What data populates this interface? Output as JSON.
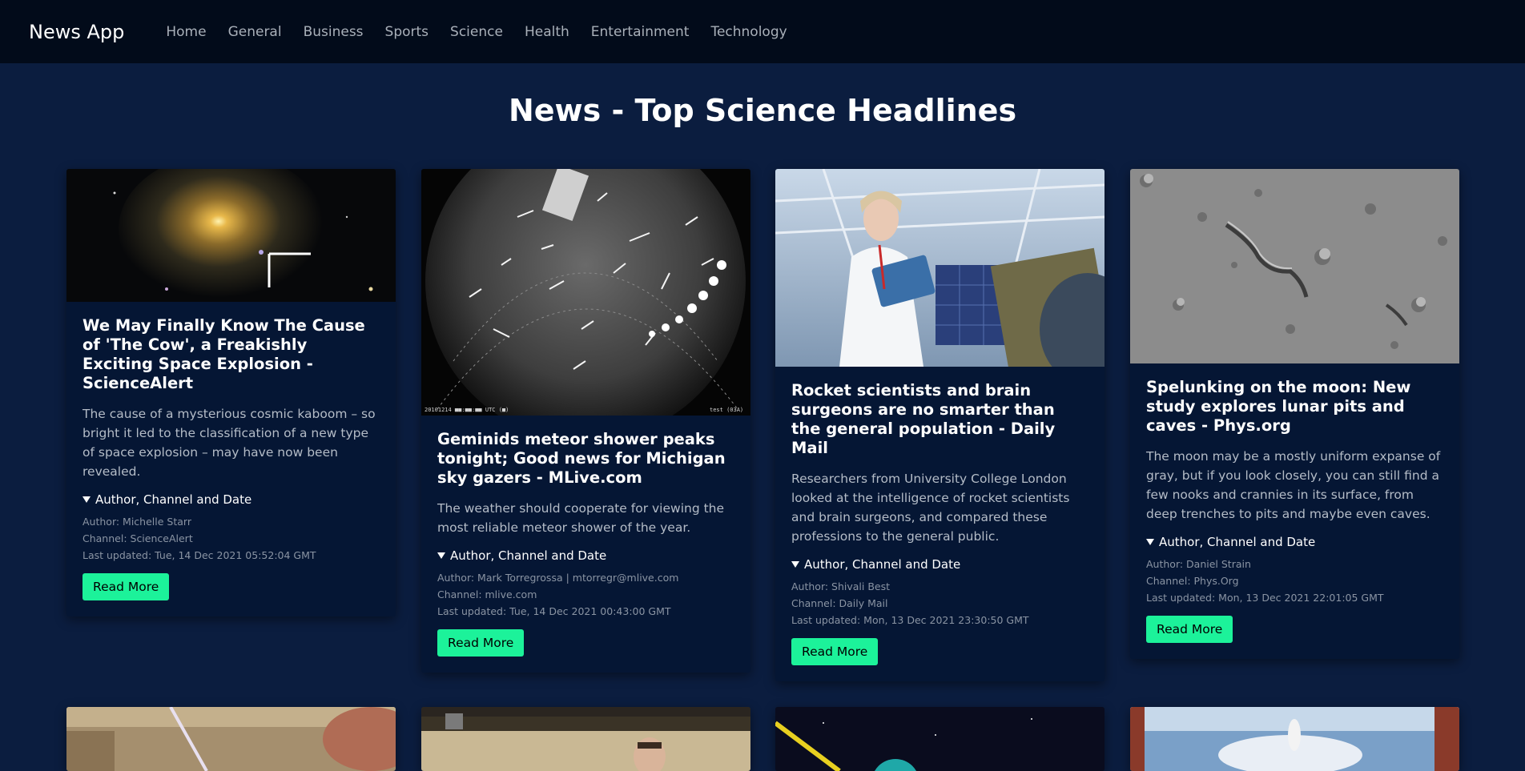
{
  "nav": {
    "brand": "News App",
    "links": [
      "Home",
      "General",
      "Business",
      "Sports",
      "Science",
      "Health",
      "Entertainment",
      "Technology"
    ]
  },
  "page": {
    "title": "News - Top Science Headlines"
  },
  "labels": {
    "details_summary": "Author, Channel and Date",
    "read_more": "Read More"
  },
  "articles": [
    {
      "title": "We May Finally Know The Cause of 'The Cow', a Freakishly Exciting Space Explosion - ScienceAlert",
      "description": "The cause of a mysterious cosmic kaboom – so bright it led to the classification of a new type of space explosion – may have now been revealed.",
      "author": "Author: Michelle Starr",
      "channel": "Channel: ScienceAlert",
      "updated": "Last updated: Tue, 14 Dec 2021 05:52:04 GMT",
      "image": "galaxy-explosion-image"
    },
    {
      "title": "Geminids meteor shower peaks tonight; Good news for Michigan sky gazers - MLive.com",
      "description": "The weather should cooperate for viewing the most reliable meteor shower of the year.",
      "author": "Author: Mark Torregrossa | mtorregr@mlive.com",
      "channel": "Channel: mlive.com",
      "updated": "Last updated: Tue, 14 Dec 2021 00:43:00 GMT",
      "image": "meteor-allsky-image",
      "image_caption_left": "20101214 ■■:■■:■■ UTC (■)",
      "image_caption_right": "test (03A)"
    },
    {
      "title": "Rocket scientists and brain surgeons are no smarter than the general population - Daily Mail",
      "description": "Researchers from University College London looked at the intelligence of rocket scientists and brain surgeons, and compared these professions to the general public.",
      "author": "Author: Shivali Best",
      "channel": "Channel: Daily Mail",
      "updated": "Last updated: Mon, 13 Dec 2021 23:30:50 GMT",
      "image": "scientist-tablet-image"
    },
    {
      "title": "Spelunking on the moon: New study explores lunar pits and caves - Phys.org",
      "description": "The moon may be a mostly uniform expanse of gray, but if you look closely, you can still find a few nooks and crannies in its surface, from deep trenches to pits and maybe even caves.",
      "author": "Author: Daniel Strain",
      "channel": "Channel: Phys.Org",
      "updated": "Last updated: Mon, 13 Dec 2021 22:01:05 GMT",
      "image": "lunar-surface-image"
    }
  ],
  "colors": {
    "page_bg": "#0b1d3f",
    "navbar_bg": "#020b1a",
    "card_bg": "#051634",
    "button_bg": "#1cf29a"
  }
}
